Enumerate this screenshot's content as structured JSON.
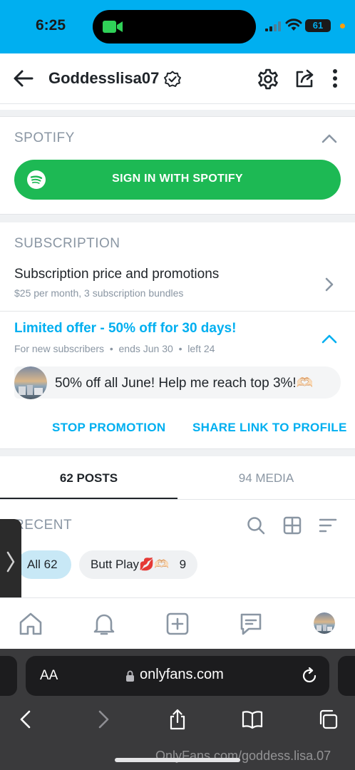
{
  "status_bar": {
    "time": "6:25",
    "battery": "61",
    "battery_level": 0.61
  },
  "header": {
    "profile_name": "Goddesslisa07"
  },
  "spotify": {
    "section_title": "SPOTIFY",
    "button_label": "SIGN IN WITH SPOTIFY",
    "brand_color": "#1db954"
  },
  "subscription": {
    "section_title": "SUBSCRIPTION",
    "row_title": "Subscription price and promotions",
    "row_detail": "$25 per month, 3 subscription bundles"
  },
  "promotion": {
    "title": "Limited offer - 50% off for 30 days!",
    "audience": "For new subscribers",
    "ends": "ends Jun 30",
    "left": "left 24",
    "message": "50% off all June! Help me reach top 3%!🫶🏻",
    "stop_label": "STOP PROMOTION",
    "share_label": "SHARE LINK TO PROFILE",
    "accent_color": "#00aff0"
  },
  "tabs": [
    {
      "label": "62 POSTS",
      "active": true
    },
    {
      "label": "94 MEDIA",
      "active": false
    }
  ],
  "recent": {
    "section_title": "RECENT",
    "chips": [
      {
        "label": "All",
        "count": "62",
        "selected": true
      },
      {
        "label": "Butt Play💋🫶🏻",
        "count": "9",
        "selected": false
      }
    ]
  },
  "browser": {
    "aa_label": "AA",
    "url": "onlyfans.com",
    "watermark": "OnlyFans.com/goddess.lisa.07"
  },
  "icons": [
    "video-camera-icon",
    "signal-icon",
    "wifi-icon",
    "battery-icon",
    "back-arrow-icon",
    "verified-icon",
    "gear-icon",
    "share-icon",
    "more-vertical-icon",
    "spotify-icon",
    "chevron-up-icon",
    "chevron-right-icon",
    "search-icon",
    "grid-icon",
    "sort-icon",
    "home-icon",
    "bell-icon",
    "add-post-icon",
    "messages-icon",
    "lock-icon",
    "reload-icon",
    "safari-back-icon",
    "safari-forward-icon",
    "safari-share-icon",
    "bookmarks-icon",
    "tabs-icon"
  ]
}
